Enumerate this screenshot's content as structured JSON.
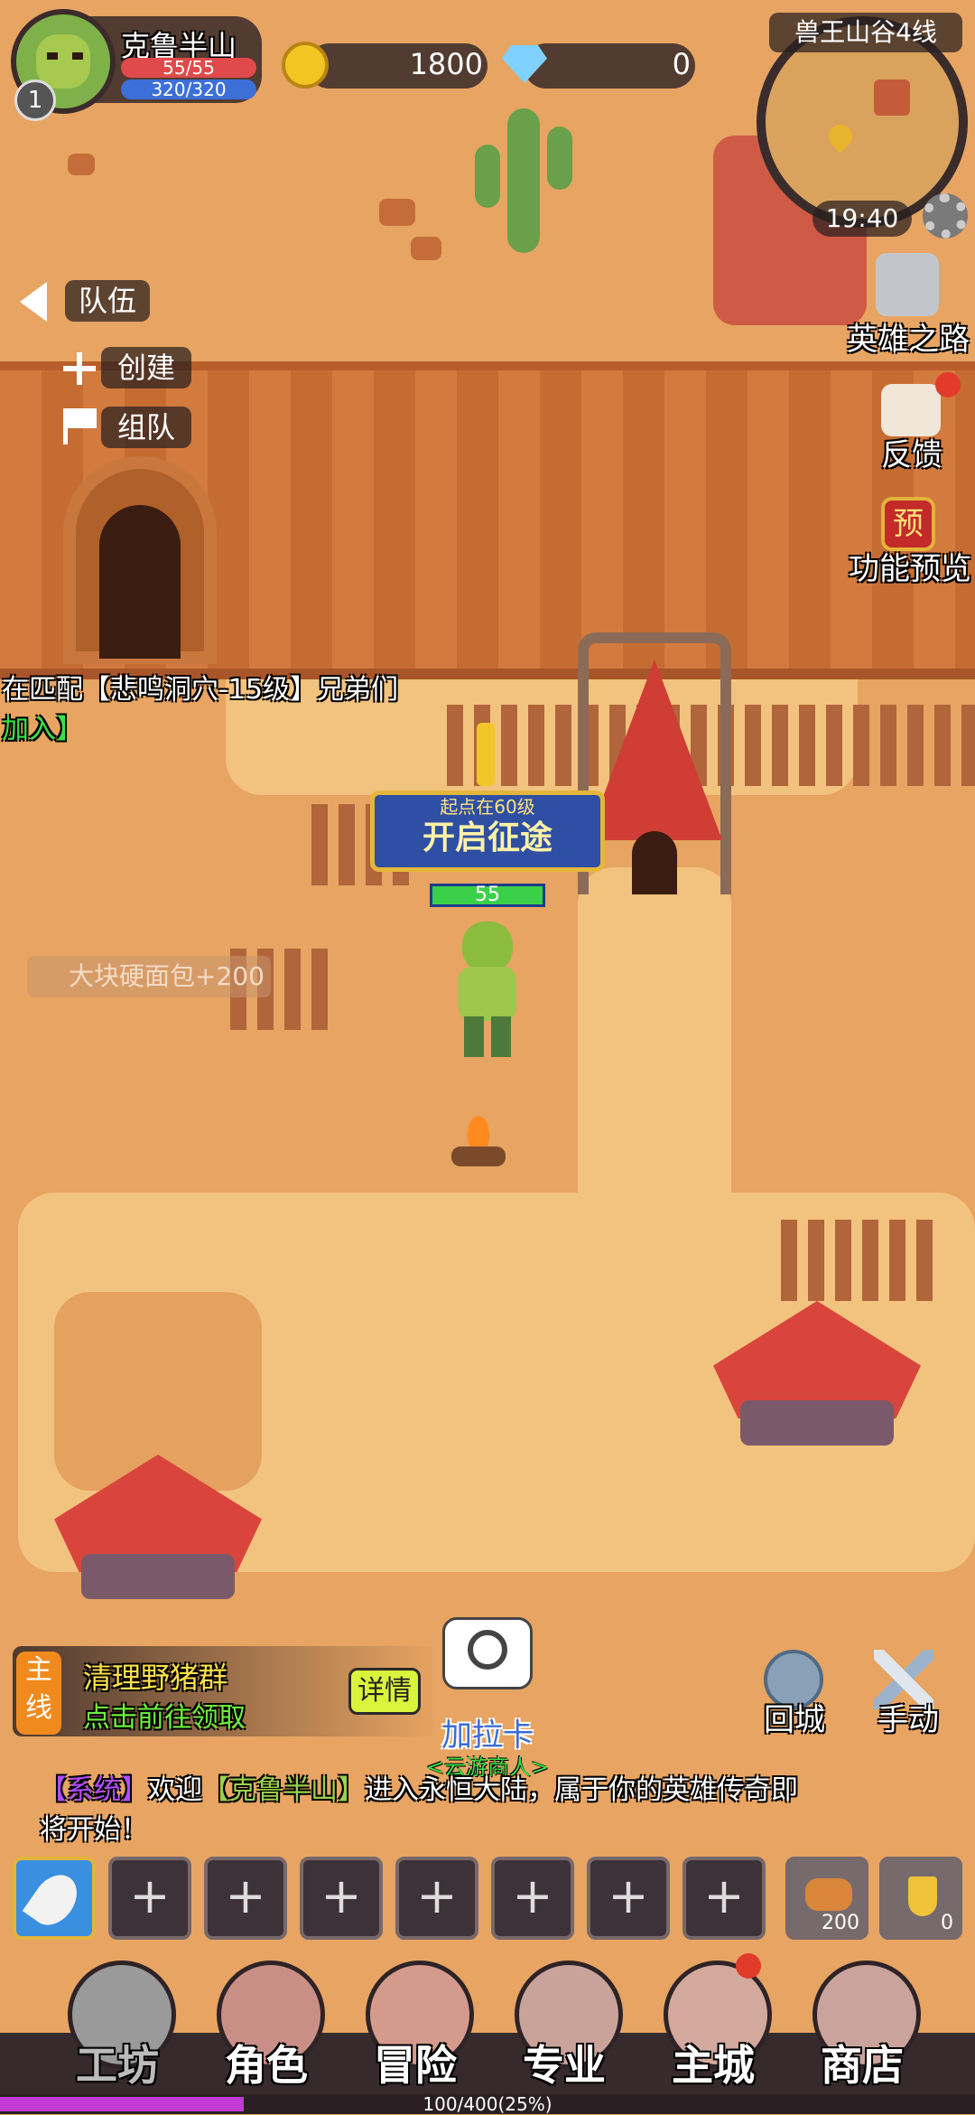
{
  "player": {
    "name": "克鲁半山",
    "level": "1",
    "hp": "55/55",
    "mp": "320/320",
    "hp_fill": 1.0,
    "mp_fill": 1.0
  },
  "currency": {
    "gold": "1800",
    "diamonds": "0"
  },
  "minimap": {
    "zone": "兽王山谷4线",
    "time": "19:40"
  },
  "team_panel": {
    "title": "队伍",
    "create": "创建",
    "join_team": "组队"
  },
  "right_menu": {
    "hero_road": "英雄之路",
    "feedback": "反馈",
    "preview": "功能预览",
    "preview_badge": "预"
  },
  "world_chat": {
    "line1": "在匹配【悲鸣洞穴-15级】兄弟们",
    "join_link": "加入】"
  },
  "map": {
    "banner_sub": "起点在60级",
    "banner_main": "开启征途",
    "player_level_tag": "55",
    "loot_popup": "大块硬面包+200",
    "npc_name": "加拉卡",
    "npc_title": "<云游商人>"
  },
  "quest": {
    "type_line1": "主",
    "type_line2": "线",
    "title": "清理野猪群",
    "hint": "点击前往领取",
    "detail": "详情"
  },
  "actions": {
    "return_city": "回城",
    "manual": "手动"
  },
  "system_msg": {
    "tag": "【系统】",
    "prefix": "欢迎",
    "name": "【克鲁半山】",
    "suffix": "进入永恒大陆，属于你的英雄传奇即",
    "line2": "将开始！"
  },
  "hotbar": {
    "slots": [
      "+",
      "+",
      "+",
      "+",
      "+",
      "+",
      "+"
    ],
    "bread_count": "200",
    "potion_count": "0"
  },
  "bottom_nav": [
    "工坊",
    "角色",
    "冒险",
    "专业",
    "主城",
    "商店"
  ],
  "xp": {
    "text": "100/400(25%)",
    "fill": 0.25
  },
  "colors": {
    "hp": "#e04a4a",
    "mp": "#3d6fd8",
    "quest_title": "#ffe14a",
    "quest_hint": "#6cf03b",
    "system_tag": "#b14bff",
    "join_link": "#36e24a",
    "npc_name": "#3b6dd6",
    "xp": "#c23bd6"
  }
}
